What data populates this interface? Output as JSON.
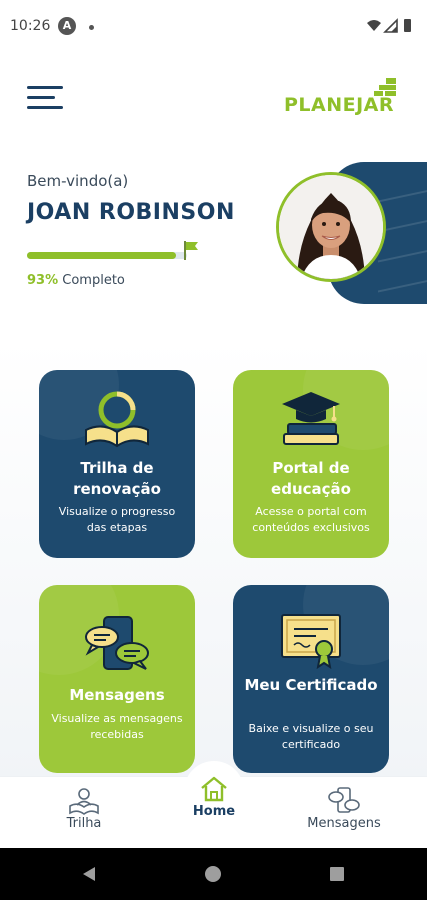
{
  "status_bar": {
    "time": "10:26",
    "app_badge": "A"
  },
  "header": {
    "logo_text": "PLANEJAR"
  },
  "profile": {
    "greeting": "Bem-vindo(a)",
    "name": "JOAN ROBINSON",
    "progress_percent": 93,
    "progress_percent_label": "93%",
    "progress_label": "Completo"
  },
  "cards": [
    {
      "title": "Trilha de renovação",
      "description": "Visualize o progresso das etapas",
      "icon": "open-book-progress-icon",
      "color": "#1e4a6e"
    },
    {
      "title": "Portal de educação",
      "description": "Acesse o portal com conteúdos exclusivos",
      "icon": "graduation-cap-books-icon",
      "color": "#9dc83a"
    },
    {
      "title": "Mensagens",
      "description": "Visualize as mensagens recebidas",
      "icon": "phone-chat-bubbles-icon",
      "color": "#9dc83a"
    },
    {
      "title": "Meu Certificado",
      "description": "Baixe e visualize o seu certificado",
      "icon": "certificate-icon",
      "color": "#1e4a6e"
    }
  ],
  "bottom_nav": [
    {
      "label": "Trilha",
      "icon": "book-person-icon",
      "active": false
    },
    {
      "label": "Home",
      "icon": "home-icon",
      "active": true
    },
    {
      "label": "Mensagens",
      "icon": "messages-icon",
      "active": false
    }
  ],
  "colors": {
    "navy": "#1b3f63",
    "card_dark": "#1e4a6e",
    "accent_green": "#8fbf2a",
    "card_green": "#9dc83a"
  }
}
